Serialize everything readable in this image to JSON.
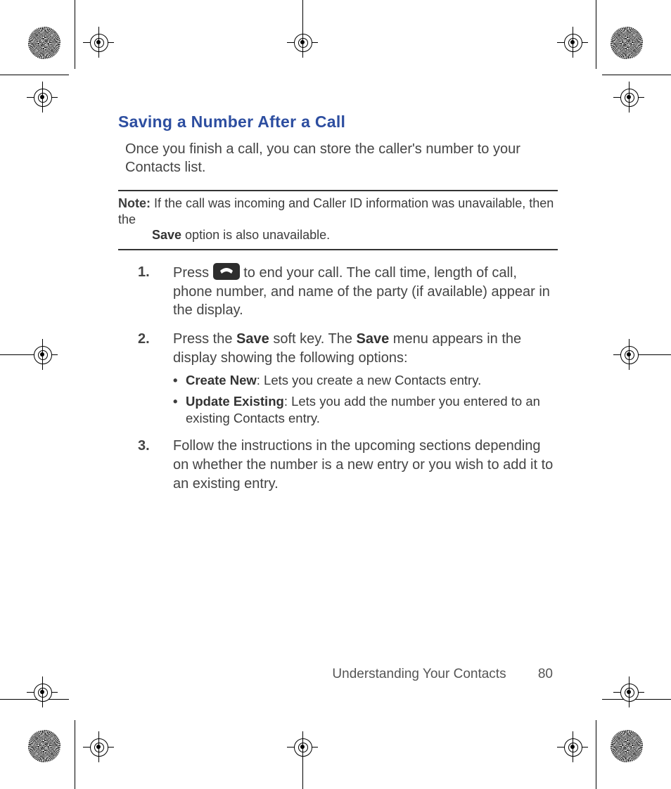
{
  "heading": "Saving a Number After a Call",
  "intro": "Once you finish a call, you can store the caller's number to your Contacts list.",
  "note": {
    "label": "Note:",
    "line1": "If the call was incoming and Caller ID information was unavailable, then the",
    "bold_word": "Save",
    "line2_tail": " option is also unavailable."
  },
  "steps": [
    {
      "num": "1.",
      "pre": "Press ",
      "post": " to end your call. The call time, length of call, phone number, and name of the party (if available) appear in the display."
    },
    {
      "num": "2.",
      "t1": "Press the ",
      "b1": "Save",
      "t2": " soft key. The ",
      "b2": "Save",
      "t3": " menu appears in the display showing the following options:",
      "opts": [
        {
          "b": "Create New",
          "t": ": Lets you create a new Contacts entry."
        },
        {
          "b": "Update Existing",
          "t": ": Lets you add the number you entered to an existing Contacts entry."
        }
      ]
    },
    {
      "num": "3.",
      "t": "Follow the instructions in the upcoming sections depending on whether the number is a new entry or you wish to add it to an existing entry."
    }
  ],
  "footer": {
    "section": "Understanding Your Contacts",
    "page": "80"
  }
}
